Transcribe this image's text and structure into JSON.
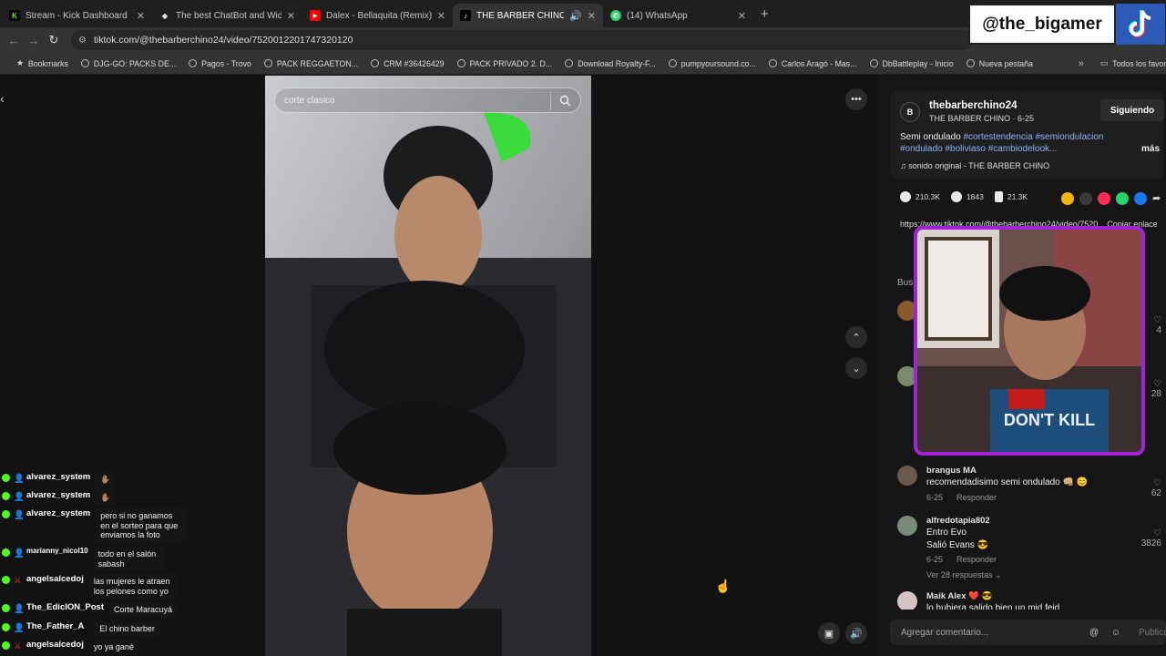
{
  "browser": {
    "tabs": [
      {
        "title": "Stream - Kick Dashboard",
        "icon": "kick-icon",
        "color": "#53fc18",
        "glyph": "K"
      },
      {
        "title": "The best ChatBot and Widgets",
        "icon": "diamond-icon",
        "color": "#cccccc",
        "glyph": "◆"
      },
      {
        "title": "Dalex - Bellaquita (Remix) ft. Le",
        "icon": "youtube-icon",
        "color": "#ff0000",
        "glyph": "▶"
      },
      {
        "title": "THE BARBER CHINO (@the",
        "icon": "tiktok-icon",
        "color": "#111111",
        "glyph": "♪",
        "active": true
      },
      {
        "title": "(14) WhatsApp",
        "icon": "whatsapp-icon",
        "color": "#25d366",
        "glyph": "✆"
      }
    ],
    "url": "tiktok.com/@thebarberchino24/video/7520012201747320120",
    "bookmarks": [
      "Bookmarks",
      "DJG-GO: PACKS DE...",
      "Pagos - Trovo",
      "PACK REGGAETON...",
      "CRM #36426429",
      "PACK PRIVADO 2. D...",
      "Download Royalty-F...",
      "pumpyoursound.co...",
      "Carlos Aragó - Mas...",
      "DbBattleplay - Inicio",
      "Nueva pestaña"
    ],
    "bookmarks_folder": "Todos los favoritos"
  },
  "overlay": {
    "handle": "@the_bigamer"
  },
  "video": {
    "search_text": "corte clasico"
  },
  "creator": {
    "initial": "B",
    "username": "thebarberchino24",
    "subtitle": "THE BARBER CHINO · 6-25",
    "follow_label": "Siguiendo",
    "desc_plain": "Semi ondulado ",
    "desc_tags": "#cortestendencia #semiondulacion #ondulado #boliviaso #cambiodelook...",
    "more_label": "más",
    "sound": "♫  sonido original - THE BARBER CHINO"
  },
  "stats": {
    "likes": "210.3K",
    "comments": "1843",
    "saves": "21.3K"
  },
  "share_colors": [
    "#f2b705",
    "#3a3a3a",
    "#fe2c55",
    "#25d366",
    "#1877f2"
  ],
  "link_row": "https://www.tiktok.com/@thebarberchino24/video/7520...   Copiar enlace",
  "comments_search": "Bus",
  "comments": [
    {
      "user": "",
      "text": "",
      "meta": "",
      "likes": "4"
    },
    {
      "user": "",
      "text": "",
      "meta": "",
      "likes": "28"
    },
    {
      "user": "brangus MA",
      "text": "recomendadisimo semi ondulado 👊🏼 😊",
      "meta": "6-25      Responder",
      "likes": "62"
    },
    {
      "user": "alfredotapia802",
      "text": "Entro Evo\nSalió Evans 😎",
      "meta": "6-25      Responder",
      "likes": "3826",
      "replies": "Ver 28 respuestas ⌄"
    },
    {
      "user": "Maik Alex ❤️ 😎",
      "text": "lo hubiera salido bien un mid feid",
      "meta": "",
      "likes": ""
    }
  ],
  "comment_input": {
    "placeholder": "Agregar comentario...",
    "publish": "Publicar"
  },
  "chat": [
    {
      "user": "alvarez_system",
      "text": "",
      "emote": "✋🏽",
      "badge": "person"
    },
    {
      "user": "alvarez_system",
      "text": "",
      "emote": "✋🏽",
      "badge": "person"
    },
    {
      "user": "alvarez_system",
      "text": "pero si no ganamos en el sorteo para que enviamos la foto",
      "badge": "person"
    },
    {
      "user": "marianny_nicol10",
      "text": "todo en el salón sabash",
      "badge": "person"
    },
    {
      "user": "angelsalcedoj",
      "text": "las mujeres le atraen los pelones como yo",
      "badge": "sword"
    },
    {
      "user": "The_EdicION_Post",
      "text": "Corte Maracuyá",
      "badge": "person"
    },
    {
      "user": "The_Father_A",
      "text": "El chino barber",
      "badge": "person"
    },
    {
      "user": "angelsalcedoj",
      "text": "yo ya gané",
      "badge": "sword"
    }
  ]
}
